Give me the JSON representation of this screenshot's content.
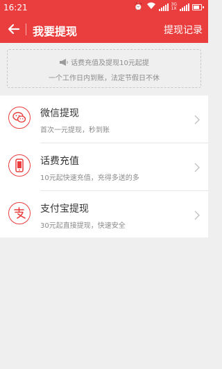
{
  "status_bar": {
    "time": "16:21",
    "network_labels": [
      "3G",
      "1X"
    ]
  },
  "header": {
    "title": "我要提现",
    "right_link": "提现记录"
  },
  "notice": {
    "line1": "话费充值及提现10元起提",
    "line2": "一个工作日内到账，法定节假日不休"
  },
  "options": [
    {
      "icon": "wechat-icon",
      "title": "微信提现",
      "subtitle": "首次一元提现，秒到账"
    },
    {
      "icon": "phone-icon",
      "title": "话费充值",
      "subtitle": "10元起快速充值，充得多送的多"
    },
    {
      "icon": "alipay-icon",
      "title": "支付宝提现",
      "subtitle": "30元起直接提现，快速安全"
    }
  ],
  "colors": {
    "brand_red": "#ea3d3d",
    "background": "#efefef"
  }
}
